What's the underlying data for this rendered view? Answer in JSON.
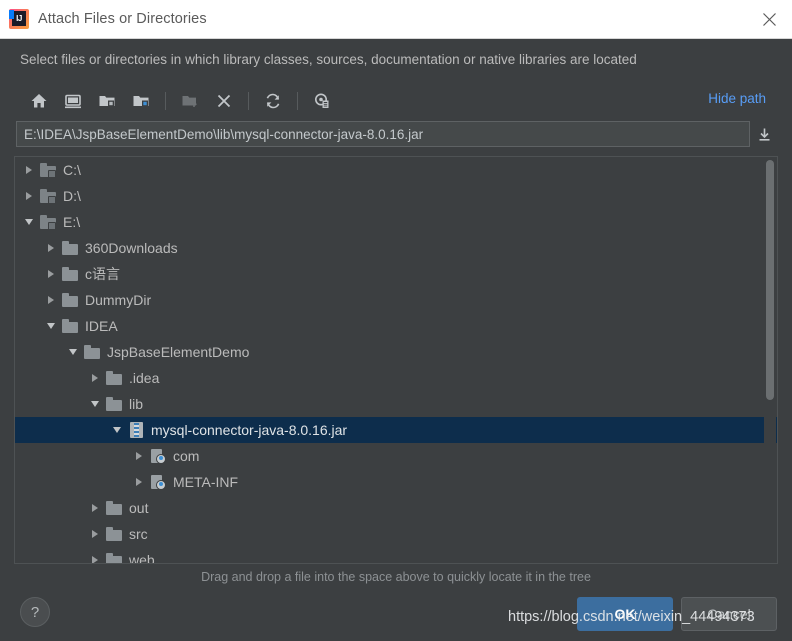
{
  "window": {
    "title": "Attach Files or Directories",
    "logo_icon": "intellij-idea-logo",
    "close_icon": "close-icon"
  },
  "description": "Select files or directories in which library classes, sources, documentation or native libraries are located",
  "toolbar": {
    "buttons": [
      {
        "name": "home-icon",
        "tooltip": "Home",
        "enabled": true
      },
      {
        "name": "desktop-icon",
        "tooltip": "Desktop",
        "enabled": true
      },
      {
        "name": "project-folder-icon",
        "tooltip": "Project Directory",
        "enabled": true
      },
      {
        "name": "module-folder-icon",
        "tooltip": "Module Directory",
        "enabled": true
      },
      {
        "name": "new-folder-icon",
        "tooltip": "New Folder",
        "enabled": false
      },
      {
        "name": "delete-icon",
        "tooltip": "Delete",
        "enabled": true
      },
      {
        "name": "refresh-icon",
        "tooltip": "Refresh",
        "enabled": true
      },
      {
        "name": "show-hidden-files-icon",
        "tooltip": "Show Hidden Files and Directories",
        "enabled": true
      }
    ],
    "hide_path_label": "Hide path"
  },
  "path_field": {
    "value": "E:\\IDEA\\JspBaseElementDemo\\lib\\mysql-connector-java-8.0.16.jar",
    "placeholder": "",
    "drop_icon": "download-arrow-icon"
  },
  "tree": {
    "rows": [
      {
        "label": "C:\\",
        "indent": 0,
        "toggle": "collapsed",
        "icon": "drive-folder-icon",
        "selected": false
      },
      {
        "label": "D:\\",
        "indent": 0,
        "toggle": "collapsed",
        "icon": "drive-folder-icon",
        "selected": false
      },
      {
        "label": "E:\\",
        "indent": 0,
        "toggle": "expanded",
        "icon": "drive-folder-icon",
        "selected": false
      },
      {
        "label": "360Downloads",
        "indent": 1,
        "toggle": "collapsed",
        "icon": "folder-icon",
        "selected": false
      },
      {
        "label": "c语言",
        "indent": 1,
        "toggle": "collapsed",
        "icon": "folder-icon",
        "selected": false
      },
      {
        "label": "DummyDir",
        "indent": 1,
        "toggle": "collapsed",
        "icon": "folder-icon",
        "selected": false
      },
      {
        "label": "IDEA",
        "indent": 1,
        "toggle": "expanded",
        "icon": "folder-icon",
        "selected": false
      },
      {
        "label": "JspBaseElementDemo",
        "indent": 2,
        "toggle": "expanded",
        "icon": "folder-icon",
        "selected": false
      },
      {
        "label": ".idea",
        "indent": 3,
        "toggle": "collapsed",
        "icon": "folder-icon",
        "selected": false
      },
      {
        "label": "lib",
        "indent": 3,
        "toggle": "expanded",
        "icon": "folder-icon",
        "selected": false
      },
      {
        "label": "mysql-connector-java-8.0.16.jar",
        "indent": 4,
        "toggle": "expanded",
        "icon": "jar-file-icon",
        "selected": true
      },
      {
        "label": "com",
        "indent": 5,
        "toggle": "collapsed",
        "icon": "package-icon",
        "selected": false
      },
      {
        "label": "META-INF",
        "indent": 5,
        "toggle": "collapsed",
        "icon": "package-icon",
        "selected": false
      },
      {
        "label": "out",
        "indent": 3,
        "toggle": "collapsed",
        "icon": "folder-icon",
        "selected": false
      },
      {
        "label": "src",
        "indent": 3,
        "toggle": "collapsed",
        "icon": "folder-icon",
        "selected": false
      },
      {
        "label": "web",
        "indent": 3,
        "toggle": "collapsed",
        "icon": "folder-icon",
        "selected": false
      }
    ]
  },
  "hint": "Drag and drop a file into the space above to quickly locate it in the tree",
  "footer": {
    "help_label": "?",
    "ok_label": "OK",
    "cancel_label": "Cancel"
  },
  "watermark": "https://blog.csdn.net/weixin_44494373",
  "colors": {
    "dialog_bg": "#3c3f41",
    "titlebar_bg": "#ffffff",
    "selection_bg": "#0d2d4c",
    "link": "#589df6",
    "ok_button": "#3c6e9f"
  }
}
